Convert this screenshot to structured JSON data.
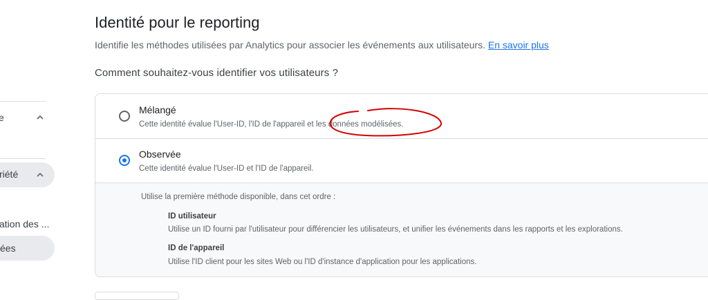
{
  "sidebar": {
    "items": [
      {
        "label": "e"
      },
      {
        "label": "riété"
      },
      {
        "label": "ation des ..."
      },
      {
        "label": "ées"
      }
    ]
  },
  "header": {
    "title": "Identité pour le reporting",
    "subtitle": "Identifie les méthodes utilisées par Analytics pour associer les événements aux utilisateurs.",
    "learn_more": "En savoir plus"
  },
  "question": "Comment souhaitez-vous identifier vos utilisateurs ?",
  "options": [
    {
      "title": "Mélangé",
      "description": "Cette identité évalue l'User-ID, l'ID de l'appareil et les données modélisées.",
      "selected": false
    },
    {
      "title": "Observée",
      "description": "Cette identité évalue l'User-ID et l'ID de l'appareil.",
      "selected": true
    }
  ],
  "details": {
    "intro": "Utilise la première méthode disponible, dans cet ordre :",
    "methods": [
      {
        "title": "ID utilisateur",
        "description": "Utilise un ID fourni par l'utilisateur pour différencier les utilisateurs, et unifier les événements dans les rapports et les explorations."
      },
      {
        "title": "ID de l'appareil",
        "description": "Utilise l'ID client pour les sites Web ou l'ID d'instance d'application pour les applications."
      }
    ]
  },
  "colors": {
    "accent": "#1a73e8",
    "annotation": "#d50000"
  },
  "icons": {
    "expand": "chevron-up-icon"
  }
}
